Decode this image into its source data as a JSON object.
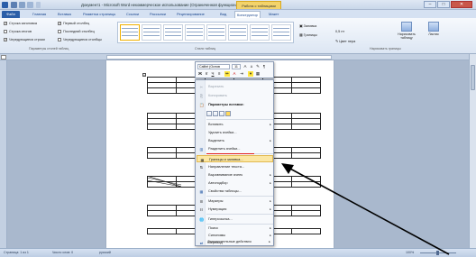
{
  "titlebar": {
    "title": "Документ1 - Microsoft Word некоммерческое использование (Ограниченная функциональность)",
    "context_tab": "Работа с таблицами"
  },
  "tabs": {
    "file": "Файл",
    "items": [
      "Главная",
      "Вставка",
      "Разметка страницы",
      "Ссылки",
      "Рассылки",
      "Рецензирование",
      "Вид",
      "Конструктор",
      "Макет"
    ],
    "active": "Конструктор"
  },
  "ribbon": {
    "options": [
      {
        "label": "Строка заголовка",
        "checked": true
      },
      {
        "label": "Строка итогов",
        "checked": false
      },
      {
        "label": "Чередующиеся строки",
        "checked": true
      },
      {
        "label": "Первый столбец",
        "checked": true
      },
      {
        "label": "Последний столбец",
        "checked": false
      },
      {
        "label": "Чередующиеся столбцы",
        "checked": false
      }
    ],
    "group_options_label": "Параметры стилей таблиц",
    "group_styles_label": "Стили таблиц",
    "group_borders_label": "Нарисовать границы",
    "shading": "Заливка",
    "borders": "Границы",
    "line_weight": "0,5 пт",
    "pen_color": "Цвет пера",
    "draw_table": "Нарисовать таблицу",
    "eraser": "Ластик"
  },
  "mini_toolbar": {
    "font": "Calibri (Основ",
    "size": "11",
    "buttons": [
      "A",
      "A",
      "A",
      "Ж",
      "К",
      "Ч",
      "A"
    ]
  },
  "context_menu": {
    "items": [
      {
        "label": "Вырезать",
        "disabled": true
      },
      {
        "label": "Копировать",
        "disabled": true
      },
      {
        "label": "Параметры вставки:",
        "bold": true
      },
      {
        "label": "Вставить",
        "submenu": true
      },
      {
        "label": "Удалить ячейки...",
        "disabled": false
      },
      {
        "label": "Выделить",
        "submenu": true
      },
      {
        "label": "Разделить ячейки..."
      },
      {
        "label": "Границы и заливка..."
      },
      {
        "label": "Направление текста..."
      },
      {
        "label": "Выравнивание ячеек",
        "submenu": true
      },
      {
        "label": "Автоподбор",
        "submenu": true
      },
      {
        "label": "Свойства таблицы..."
      },
      {
        "label": "Маркеры",
        "submenu": true
      },
      {
        "label": "Нумерация",
        "submenu": true
      },
      {
        "label": "Гиперссылка..."
      },
      {
        "label": "Поиск",
        "submenu": true
      },
      {
        "label": "Синонимы",
        "submenu": true
      },
      {
        "label": "Перевод"
      },
      {
        "label": "Дополнительные действия",
        "submenu": true
      }
    ]
  },
  "statusbar": {
    "page": "Страница: 1 из 1",
    "words": "Число слов: 0",
    "language": "русский",
    "zoom": "100%"
  },
  "colors": {
    "accent": "#2a5ea8",
    "context_tab": "#f3d36b",
    "highlight": "#fbe7a4",
    "red_underline": "#e21d1d"
  }
}
